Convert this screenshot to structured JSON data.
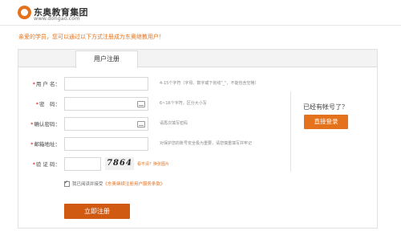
{
  "header": {
    "logo_name": "东奥教育集团",
    "logo_url": "www.dongao.com"
  },
  "welcome_text": "亲爱的学员，您可以通过以下方式注册成为东奥继教用户！",
  "tab_label": "用户注册",
  "form": {
    "username": {
      "label": "用 户 名：",
      "hint": "4-15个字符（字母、数字或下划线\"_\"，不能包含空格）",
      "value": ""
    },
    "password": {
      "label": "密　码：",
      "hint": "6~16个字符，区分大小写",
      "value": ""
    },
    "confirm_password": {
      "label": "确认密码：",
      "hint": "请再次填写密码",
      "value": ""
    },
    "email": {
      "label": "邮箱地址：",
      "hint": "对保护您的账号安全极为重要，请您慎重填写并牢记",
      "value": ""
    },
    "captcha": {
      "label": "验 证 码：",
      "image_text": "7864",
      "refresh_text": "看不清？换张图片",
      "value": ""
    }
  },
  "agreement": {
    "text": "我已阅读并接受",
    "link": "《东奥继续注册用户服务条款》",
    "checked": true
  },
  "register_button": "立即注册",
  "side": {
    "has_account": "已经有帐号了？",
    "login_button": "直接登录"
  },
  "colors": {
    "accent": "#e4721c",
    "button": "#d15a12"
  }
}
